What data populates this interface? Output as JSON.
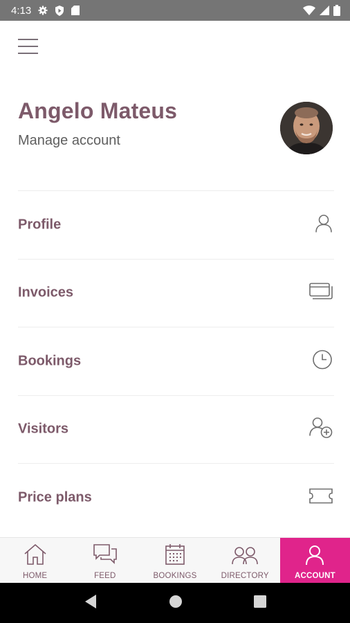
{
  "status_bar": {
    "time": "4:13"
  },
  "header": {
    "user_name": "Angelo Mateus",
    "manage_account": "Manage account"
  },
  "menu": [
    {
      "label": "Profile",
      "icon": "person-icon"
    },
    {
      "label": "Invoices",
      "icon": "cards-icon"
    },
    {
      "label": "Bookings",
      "icon": "clock-icon"
    },
    {
      "label": "Visitors",
      "icon": "add-person-icon"
    },
    {
      "label": "Price plans",
      "icon": "ticket-icon"
    }
  ],
  "bottom_nav": [
    {
      "label": "HOME",
      "icon": "home-icon"
    },
    {
      "label": "FEED",
      "icon": "chat-icon"
    },
    {
      "label": "BOOKINGS",
      "icon": "calendar-icon"
    },
    {
      "label": "DIRECTORY",
      "icon": "people-icon"
    },
    {
      "label": "ACCOUNT",
      "icon": "person-icon",
      "active": true
    }
  ],
  "colors": {
    "accent": "#e0248b",
    "primary_text": "#7d5a6a",
    "status_bar": "#757575"
  }
}
